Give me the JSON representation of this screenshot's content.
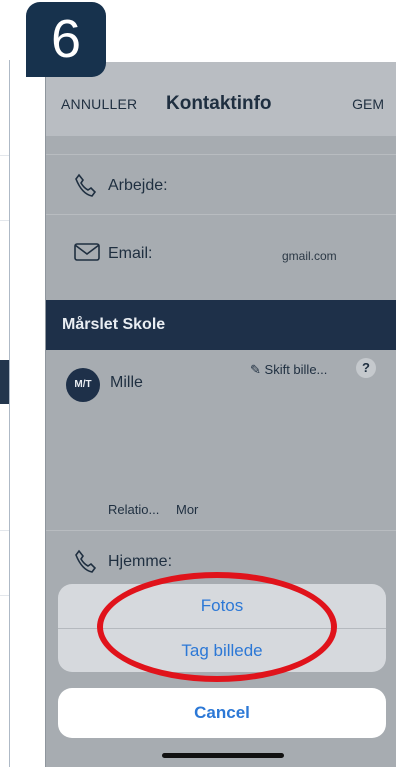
{
  "step": {
    "number": "6"
  },
  "header": {
    "cancel_label": "ANNULLER",
    "title": "Kontaktinfo",
    "save_label": "GEM"
  },
  "rows": {
    "work": {
      "label": "Arbejde:",
      "value": ""
    },
    "email": {
      "label": "Email:",
      "value": "gmail.com"
    },
    "home": {
      "label": "Hjemme:"
    }
  },
  "school": {
    "name": "Mårslet Skole"
  },
  "contact": {
    "avatar_initials": "M/T",
    "name": "Mille",
    "change_photo": "Skift bille...",
    "help": "?",
    "relation_label": "Relatio...",
    "relation_value": "Mor"
  },
  "action_sheet": {
    "options": [
      "Fotos",
      "Tag billede"
    ],
    "cancel_label": "Cancel"
  },
  "colors": {
    "accent": "#2c78d6",
    "school_bar": "#1e3049",
    "highlight": "#e0131b",
    "badge": "#17324d"
  },
  "icons": [
    "phone-icon",
    "mail-icon",
    "pencil-icon",
    "help-icon"
  ]
}
